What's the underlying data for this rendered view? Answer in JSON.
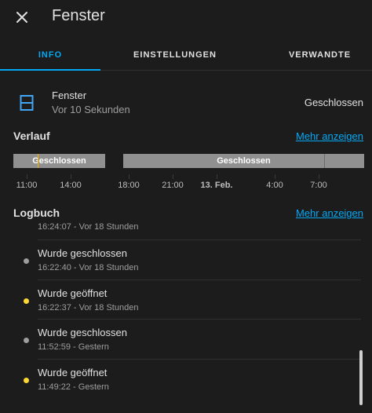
{
  "header": {
    "title": "Fenster",
    "close_icon": "close-icon"
  },
  "tabs": [
    {
      "label": "INFO",
      "active": true
    },
    {
      "label": "EINSTELLUNGEN",
      "active": false
    },
    {
      "label": "VERWANDTE",
      "active": false
    }
  ],
  "entity": {
    "icon": "window-closed-icon",
    "name": "Fenster",
    "last_changed": "Vor 10 Sekunden",
    "state": "Geschlossen"
  },
  "history": {
    "title": "Verlauf",
    "more_label": "Mehr anzeigen",
    "segments": [
      {
        "label": "Geschlossen"
      },
      {
        "label": "Geschlossen"
      }
    ],
    "ticks": [
      "11:00",
      "14:00",
      "18:00",
      "21:00",
      "13. Feb.",
      "4:00",
      "7:00"
    ]
  },
  "logbook": {
    "title": "Logbuch",
    "more_label": "Mehr anzeigen",
    "partial_entry": "16:24:07 - Vor 18 Stunden",
    "entries": [
      {
        "title": "Wurde geschlossen",
        "time": "16:22:40 - Vor 18 Stunden",
        "dot_color": "#9e9e9e"
      },
      {
        "title": "Wurde geöffnet",
        "time": "16:22:37 - Vor 18 Stunden",
        "dot_color": "#fdd835"
      },
      {
        "title": "Wurde geschlossen",
        "time": "11:52:59 - Gestern",
        "dot_color": "#9e9e9e"
      },
      {
        "title": "Wurde geöffnet",
        "time": "11:49:22 - Gestern",
        "dot_color": "#fdd835"
      }
    ]
  },
  "colors": {
    "accent": "#03a9f4",
    "closed": "#909090",
    "open": "#fdd835",
    "background": "#1c1c1c"
  }
}
